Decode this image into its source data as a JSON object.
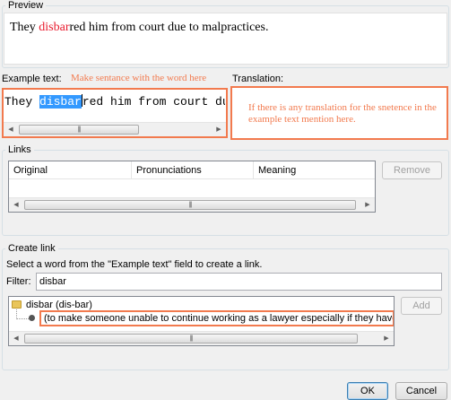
{
  "preview": {
    "title": "Preview",
    "text_before": "They ",
    "text_highlight": "disbar",
    "text_after": "red him from court due to malpractices."
  },
  "example": {
    "label": "Example text:",
    "hint": "Make sentance with the word here",
    "before": "They ",
    "selected": "disbar",
    "after": "red him from court due to malpractices."
  },
  "translation": {
    "label": "Translation:",
    "hint": "If there is any translation for the snetence in the example text mention here."
  },
  "links": {
    "title": "Links",
    "columns": [
      "Original",
      "Pronunciations",
      "Meaning"
    ],
    "remove_label": "Remove"
  },
  "create_link": {
    "title": "Create link",
    "instruction": "Select a word from the \"Example text\" field to create a link.",
    "filter_label": "Filter:",
    "filter_value": "disbar",
    "tree_root": "disbar (dis-bar)",
    "tree_child": "(to make someone unable to continue working as a lawyer especially if they have don",
    "add_label": "Add"
  },
  "dialog": {
    "ok_label": "OK",
    "cancel_label": "Cancel"
  },
  "colors": {
    "annotation": "#f27a4e",
    "highlight_red": "#e8192c",
    "selection": "#3399ff"
  },
  "scroll_glyphs": {
    "left": "◀",
    "right": "▶",
    "grip": "|||"
  }
}
